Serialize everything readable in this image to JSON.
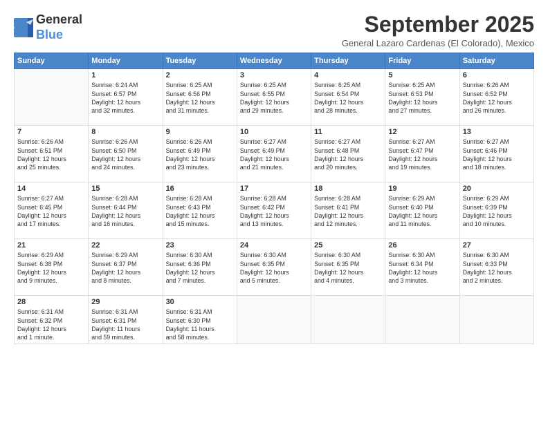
{
  "logo": {
    "general": "General",
    "blue": "Blue"
  },
  "header": {
    "month_title": "September 2025",
    "subtitle": "General Lazaro Cardenas (El Colorado), Mexico"
  },
  "days_of_week": [
    "Sunday",
    "Monday",
    "Tuesday",
    "Wednesday",
    "Thursday",
    "Friday",
    "Saturday"
  ],
  "weeks": [
    [
      {
        "day": "",
        "info": ""
      },
      {
        "day": "1",
        "info": "Sunrise: 6:24 AM\nSunset: 6:57 PM\nDaylight: 12 hours\nand 32 minutes."
      },
      {
        "day": "2",
        "info": "Sunrise: 6:25 AM\nSunset: 6:56 PM\nDaylight: 12 hours\nand 31 minutes."
      },
      {
        "day": "3",
        "info": "Sunrise: 6:25 AM\nSunset: 6:55 PM\nDaylight: 12 hours\nand 29 minutes."
      },
      {
        "day": "4",
        "info": "Sunrise: 6:25 AM\nSunset: 6:54 PM\nDaylight: 12 hours\nand 28 minutes."
      },
      {
        "day": "5",
        "info": "Sunrise: 6:25 AM\nSunset: 6:53 PM\nDaylight: 12 hours\nand 27 minutes."
      },
      {
        "day": "6",
        "info": "Sunrise: 6:26 AM\nSunset: 6:52 PM\nDaylight: 12 hours\nand 26 minutes."
      }
    ],
    [
      {
        "day": "7",
        "info": "Sunrise: 6:26 AM\nSunset: 6:51 PM\nDaylight: 12 hours\nand 25 minutes."
      },
      {
        "day": "8",
        "info": "Sunrise: 6:26 AM\nSunset: 6:50 PM\nDaylight: 12 hours\nand 24 minutes."
      },
      {
        "day": "9",
        "info": "Sunrise: 6:26 AM\nSunset: 6:49 PM\nDaylight: 12 hours\nand 23 minutes."
      },
      {
        "day": "10",
        "info": "Sunrise: 6:27 AM\nSunset: 6:49 PM\nDaylight: 12 hours\nand 21 minutes."
      },
      {
        "day": "11",
        "info": "Sunrise: 6:27 AM\nSunset: 6:48 PM\nDaylight: 12 hours\nand 20 minutes."
      },
      {
        "day": "12",
        "info": "Sunrise: 6:27 AM\nSunset: 6:47 PM\nDaylight: 12 hours\nand 19 minutes."
      },
      {
        "day": "13",
        "info": "Sunrise: 6:27 AM\nSunset: 6:46 PM\nDaylight: 12 hours\nand 18 minutes."
      }
    ],
    [
      {
        "day": "14",
        "info": "Sunrise: 6:27 AM\nSunset: 6:45 PM\nDaylight: 12 hours\nand 17 minutes."
      },
      {
        "day": "15",
        "info": "Sunrise: 6:28 AM\nSunset: 6:44 PM\nDaylight: 12 hours\nand 16 minutes."
      },
      {
        "day": "16",
        "info": "Sunrise: 6:28 AM\nSunset: 6:43 PM\nDaylight: 12 hours\nand 15 minutes."
      },
      {
        "day": "17",
        "info": "Sunrise: 6:28 AM\nSunset: 6:42 PM\nDaylight: 12 hours\nand 13 minutes."
      },
      {
        "day": "18",
        "info": "Sunrise: 6:28 AM\nSunset: 6:41 PM\nDaylight: 12 hours\nand 12 minutes."
      },
      {
        "day": "19",
        "info": "Sunrise: 6:29 AM\nSunset: 6:40 PM\nDaylight: 12 hours\nand 11 minutes."
      },
      {
        "day": "20",
        "info": "Sunrise: 6:29 AM\nSunset: 6:39 PM\nDaylight: 12 hours\nand 10 minutes."
      }
    ],
    [
      {
        "day": "21",
        "info": "Sunrise: 6:29 AM\nSunset: 6:38 PM\nDaylight: 12 hours\nand 9 minutes."
      },
      {
        "day": "22",
        "info": "Sunrise: 6:29 AM\nSunset: 6:37 PM\nDaylight: 12 hours\nand 8 minutes."
      },
      {
        "day": "23",
        "info": "Sunrise: 6:30 AM\nSunset: 6:36 PM\nDaylight: 12 hours\nand 7 minutes."
      },
      {
        "day": "24",
        "info": "Sunrise: 6:30 AM\nSunset: 6:35 PM\nDaylight: 12 hours\nand 5 minutes."
      },
      {
        "day": "25",
        "info": "Sunrise: 6:30 AM\nSunset: 6:35 PM\nDaylight: 12 hours\nand 4 minutes."
      },
      {
        "day": "26",
        "info": "Sunrise: 6:30 AM\nSunset: 6:34 PM\nDaylight: 12 hours\nand 3 minutes."
      },
      {
        "day": "27",
        "info": "Sunrise: 6:30 AM\nSunset: 6:33 PM\nDaylight: 12 hours\nand 2 minutes."
      }
    ],
    [
      {
        "day": "28",
        "info": "Sunrise: 6:31 AM\nSunset: 6:32 PM\nDaylight: 12 hours\nand 1 minute."
      },
      {
        "day": "29",
        "info": "Sunrise: 6:31 AM\nSunset: 6:31 PM\nDaylight: 11 hours\nand 59 minutes."
      },
      {
        "day": "30",
        "info": "Sunrise: 6:31 AM\nSunset: 6:30 PM\nDaylight: 11 hours\nand 58 minutes."
      },
      {
        "day": "",
        "info": ""
      },
      {
        "day": "",
        "info": ""
      },
      {
        "day": "",
        "info": ""
      },
      {
        "day": "",
        "info": ""
      }
    ]
  ]
}
